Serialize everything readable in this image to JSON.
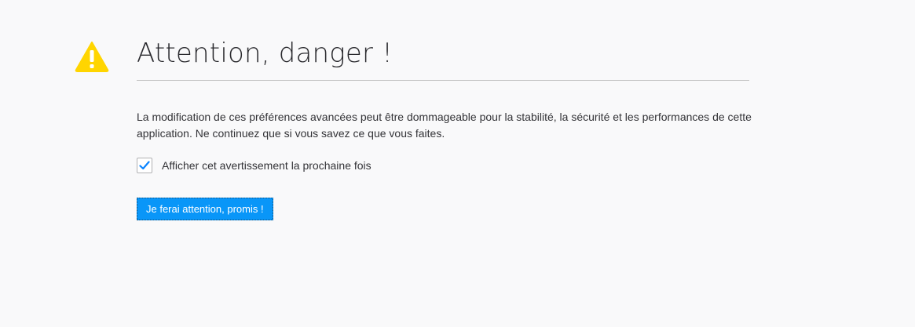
{
  "warning": {
    "icon": "warning-triangle-icon",
    "icon_color": "#ffd500",
    "title": "Attention, danger !",
    "description": "La modification de ces préférences avancées peut être dommageable pour la stabilité, la sécurité et les performances de cette application. Ne continuez que si vous savez ce que vous faites."
  },
  "checkbox": {
    "label": "Afficher cet avertissement la prochaine fois",
    "checked": true,
    "check_color": "#0a84ff"
  },
  "button": {
    "label": "Je ferai attention, promis !",
    "color": "#0996f8"
  }
}
